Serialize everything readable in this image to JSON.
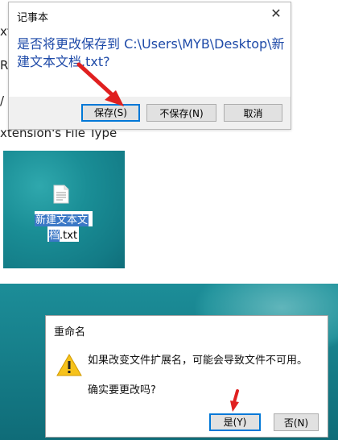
{
  "background_fragments": [
    "xt",
    "R",
    "/",
    "xtension's File Type"
  ],
  "save_dialog": {
    "title": "记事本",
    "close_glyph": "✕",
    "message": "是否将更改保存到 C:\\Users\\MYB\\Desktop\\新建文本文档.txt?",
    "buttons": {
      "save": "保存(S)",
      "dont_save": "不保存(N)",
      "cancel": "取消"
    }
  },
  "desktop": {
    "file_name_line1": "新建文本文",
    "file_name_line2_selected": "档",
    "file_name_line2_rest": ".txt"
  },
  "rename_dialog": {
    "title": "重命名",
    "message_line1": "如果改变文件扩展名，可能会导致文件不可用。",
    "message_line2": "确实要更改吗?",
    "buttons": {
      "yes": "是(Y)",
      "no": "否(N)"
    }
  },
  "colors": {
    "accent_blue": "#0078d7",
    "message_blue": "#1e4aa8",
    "arrow_red": "#e02020",
    "selection": "#3b78c6"
  },
  "icons": [
    "close-icon",
    "text-file-icon",
    "warning-icon",
    "red-arrow-icon"
  ]
}
